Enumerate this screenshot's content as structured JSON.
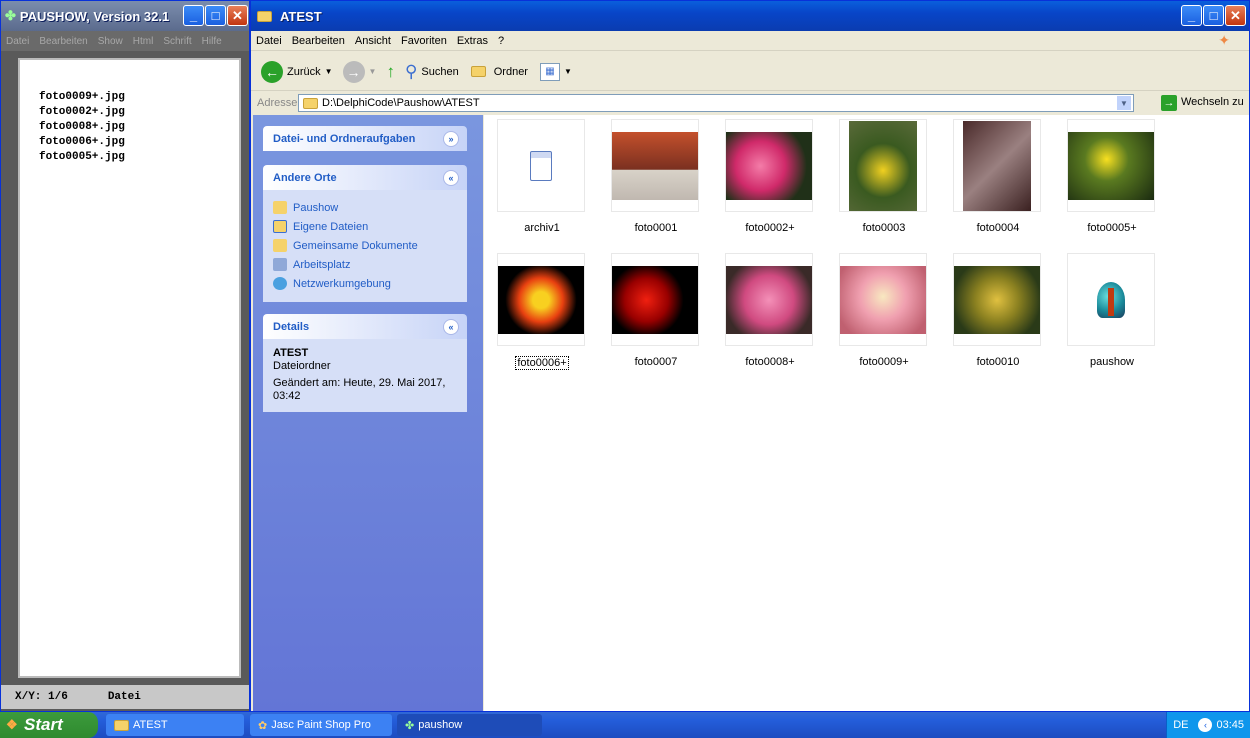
{
  "left_window": {
    "title": "PAUSHOW, Version 32.1",
    "menu": [
      "Datei",
      "Bearbeiten",
      "Show",
      "Html",
      "Schrift",
      "Hilfe"
    ],
    "files": [
      "foto0009+.jpg",
      "foto0002+.jpg",
      "foto0008+.jpg",
      "foto0006+.jpg",
      "foto0005+.jpg"
    ],
    "status_xy": "X/Y: 1/6",
    "status_label": "Datei"
  },
  "explorer": {
    "title": "ATEST",
    "menu": [
      "Datei",
      "Bearbeiten",
      "Ansicht",
      "Favoriten",
      "Extras",
      "?"
    ],
    "toolbar": {
      "back": "Zurück",
      "search": "Suchen",
      "folders": "Ordner"
    },
    "address_label": "Adresse",
    "address_value": "D:\\DelphiCode\\Paushow\\ATEST",
    "go_label": "Wechseln zu",
    "panels": {
      "tasks": {
        "title": "Datei- und Ordneraufgaben"
      },
      "places": {
        "title": "Andere Orte",
        "items": [
          "Paushow",
          "Eigene Dateien",
          "Gemeinsame Dokumente",
          "Arbeitsplatz",
          "Netzwerkumgebung"
        ]
      },
      "details": {
        "title": "Details",
        "name": "ATEST",
        "type": "Dateiordner",
        "modified": "Geändert am: Heute, 29. Mai 2017, 03:42"
      }
    },
    "files": [
      "archiv1",
      "foto0001",
      "foto0002+",
      "foto0003",
      "foto0004",
      "foto0005+",
      "foto0006+",
      "foto0007",
      "foto0008+",
      "foto0009+",
      "foto0010",
      "paushow"
    ]
  },
  "taskbar": {
    "start": "Start",
    "tasks": [
      "ATEST",
      "Jasc Paint Shop Pro",
      "paushow"
    ],
    "lang": "DE",
    "clock": "03:45"
  }
}
